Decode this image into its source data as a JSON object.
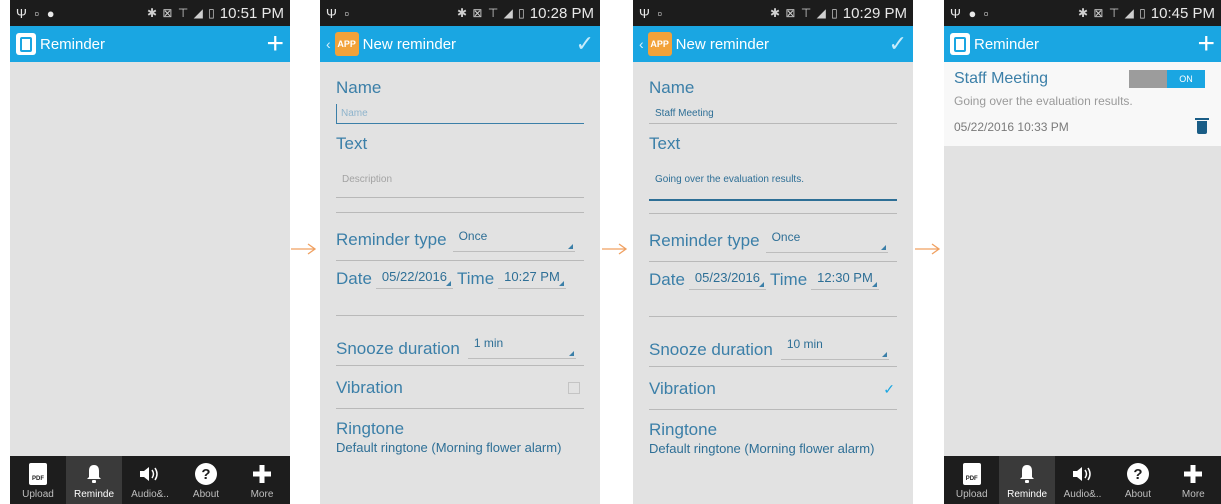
{
  "screens": [
    {
      "status": {
        "left": "Ψ ▫ ●",
        "right": "✱ ⊠ ⊤ ◢ ▯",
        "time": "10:51 PM"
      },
      "title": "Reminder"
    },
    {
      "status": {
        "left": "Ψ ▫",
        "right": "✱ ⊠ ⊤ ◢ ▯",
        "time": "10:28 PM"
      },
      "title": "New reminder",
      "badge": "APP",
      "form": {
        "name_label": "Name",
        "name_placeholder": "Name",
        "text_label": "Text",
        "text_placeholder": "Description",
        "type_label": "Reminder type",
        "type_value": "Once",
        "date_label": "Date",
        "date_value": "05/22/2016",
        "time_label": "Time",
        "time_value": "10:27 PM",
        "snooze_label": "Snooze duration",
        "snooze_value": "1 min",
        "vibration_label": "Vibration",
        "vibration_checked": false,
        "ringtone_label": "Ringtone",
        "ringtone_value": "Default ringtone (Morning flower alarm)"
      }
    },
    {
      "status": {
        "left": "Ψ ▫",
        "right": "✱ ⊠ ⊤ ◢ ▯",
        "time": "10:29 PM"
      },
      "title": "New reminder",
      "badge": "APP",
      "form": {
        "name_label": "Name",
        "name_value": "Staff Meeting",
        "text_label": "Text",
        "text_value": "Going over the evaluation results.",
        "type_label": "Reminder type",
        "type_value": "Once",
        "date_label": "Date",
        "date_value": "05/23/2016",
        "time_label": "Time",
        "time_value": "12:30 PM",
        "snooze_label": "Snooze duration",
        "snooze_value": "10 min",
        "vibration_label": "Vibration",
        "vibration_checked": true,
        "ringtone_label": "Ringtone",
        "ringtone_value": "Default ringtone (Morning flower alarm)"
      }
    },
    {
      "status": {
        "left": "Ψ ● ▫",
        "right": "✱ ⊠ ⊤ ◢ ▯",
        "time": "10:45 PM"
      },
      "title": "Reminder",
      "reminder": {
        "title": "Staff Meeting",
        "toggle": "ON",
        "text": "Going over the evaluation results.",
        "datetime": "05/22/2016 10:33 PM"
      }
    }
  ],
  "tabs": {
    "upload": "Upload",
    "reminder": "Reminde",
    "audio": "Audio&..",
    "about": "About",
    "more": "More",
    "pdf_glyph": "PDF"
  },
  "icons": {
    "menu_plus": "+",
    "check": "✓",
    "bell": "🔔",
    "speaker": "◀))",
    "about": "?",
    "back": "‹"
  },
  "colors": {
    "accent": "#1aa6e2",
    "label": "#3b7fa8",
    "tabbar": "#1d1d1d",
    "arrow": "#f0a060"
  }
}
